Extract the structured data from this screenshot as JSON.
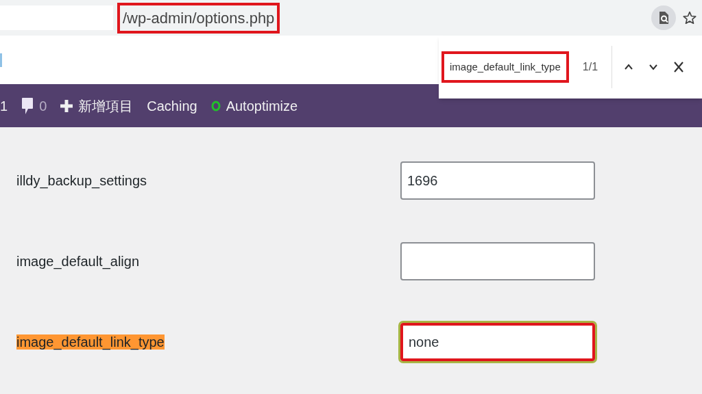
{
  "address_bar": {
    "url": "/wp-admin/options.php",
    "annotated": true
  },
  "find_bar": {
    "query": "image_default_link_type",
    "annotated": true,
    "match_count": "1/1"
  },
  "admin_bar": {
    "items": [
      {
        "kind": "text",
        "label": "1"
      },
      {
        "kind": "comments",
        "label": "0"
      },
      {
        "kind": "new",
        "label": "新增項目"
      },
      {
        "kind": "text",
        "label": "Caching"
      },
      {
        "kind": "status",
        "label": "Autoptimize"
      }
    ]
  },
  "options": [
    {
      "name": "illdy_backup_settings",
      "value": "1696",
      "highlighted": false,
      "annotated": false,
      "focused": false
    },
    {
      "name": "image_default_align",
      "highlighted": false,
      "annotated": false,
      "focused": false
    },
    {
      "name": "image_default_link_type",
      "value": "none",
      "highlighted": true,
      "annotated": true,
      "focused": true
    }
  ]
}
